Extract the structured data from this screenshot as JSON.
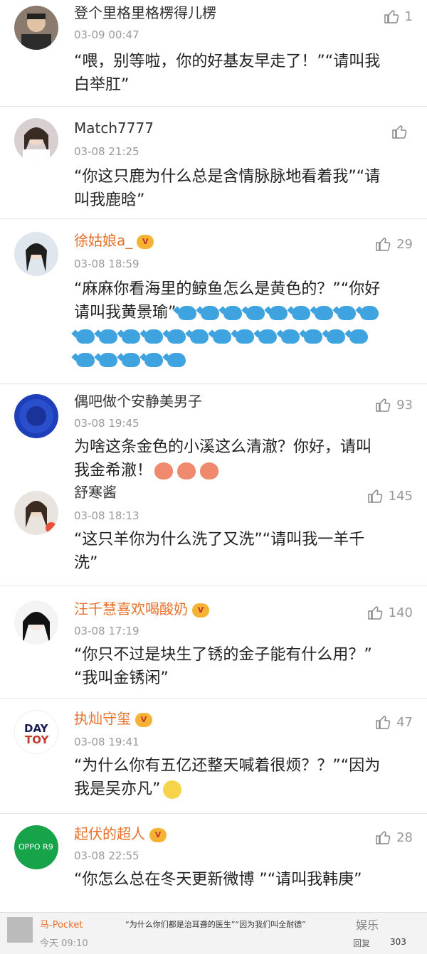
{
  "comments": [
    {
      "name": "登个里格里格楞得儿楞",
      "time": "03-09 00:47",
      "text1": "“喂，别等啦，你的好基友早走了！”“请叫我",
      "text2": "白举肛”",
      "likes": "1"
    },
    {
      "name": "Match7777",
      "time": "03-08 21:25",
      "text1": "“你这只鹿为什么总是含情脉脉地看着我”“请",
      "text2": "叫我鹿晗”",
      "likes": ""
    },
    {
      "name": "徐姑娘a_",
      "time": "03-08 18:59",
      "text1": "“麻麻你看海里的鲸鱼怎么是黄色的？”“你好",
      "text2": "请叫我黄景瑜”",
      "likes": "29"
    },
    {
      "name": "偶吧做个安静美男子",
      "time": "03-08 19:45",
      "text1": "为啥这条金色的小溪这么清澈？你好，请叫",
      "text2": "我金希澈！",
      "likes": "93"
    },
    {
      "name": "舒寒酱",
      "time": "03-08 18:13",
      "text1": "“这只羊你为什么洗了又洗”“请叫我一羊千",
      "text2": "洗”",
      "likes": "145"
    },
    {
      "name": "汪千慧喜欢喝酸奶",
      "time": "03-08 17:19",
      "text1": "“你只不过是块生了锈的金子能有什么用？”",
      "text2": "“我叫金锈闲”",
      "likes": "140"
    },
    {
      "name": "执灿守玺",
      "time": "03-08 19:41",
      "text1": "“为什么你有五亿还整天喊着很烦？？”“因为",
      "text2": "我是吴亦凡”",
      "likes": "47"
    },
    {
      "name": "起伏的超人",
      "time": "03-08 22:55",
      "text1": "“你怎么总在冬天更新微博 ”“请叫我韩庚”",
      "text2": "",
      "likes": "28"
    }
  ],
  "avatar_labels": {
    "daytoy_line1": "DAY",
    "daytoy_line2": "TOY",
    "oppo": "OPPO R9"
  },
  "bottom": {
    "name": "马-Pocket",
    "text": "“为什么你们都是治耳聋的医生”“因为我们叫全耐德”",
    "time": "今天 09:10",
    "reply": "回复",
    "likes": "303",
    "watermark": "娱乐"
  }
}
